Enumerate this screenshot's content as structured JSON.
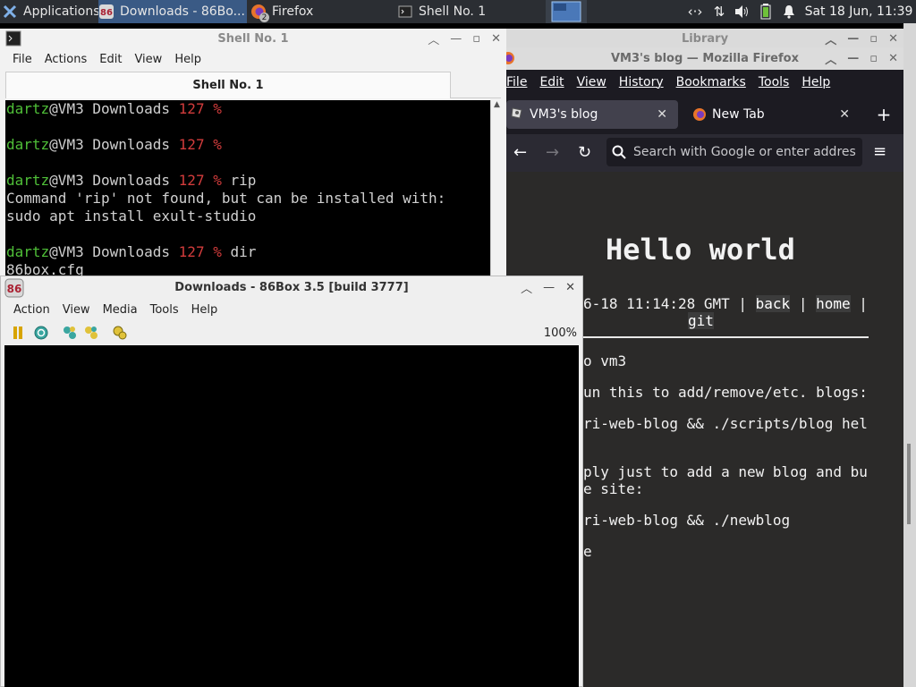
{
  "panel": {
    "apps_label": "Applications",
    "tasks": [
      {
        "label": "Downloads - 86Bo...",
        "icon": "86box-icon",
        "active": true
      },
      {
        "label": "Firefox",
        "icon": "firefox-icon",
        "badge": "2",
        "active": false
      },
      {
        "label": "Shell No. 1",
        "icon": "terminal-icon",
        "active": false
      }
    ],
    "clock": "Sat 18 Jun, 11:39",
    "tray_icons": [
      "network-arrows-icon",
      "transfer-icon",
      "volume-icon",
      "battery-icon",
      "bell-icon"
    ],
    "colors": {
      "panel_bg": "#2b2e33",
      "active_task": "#3a5a85"
    }
  },
  "library": {
    "title": "Library"
  },
  "firefox": {
    "title": "VM3's blog — Mozilla Firefox",
    "menu": [
      "File",
      "Edit",
      "View",
      "History",
      "Bookmarks",
      "Tools",
      "Help"
    ],
    "tabs": [
      {
        "label": "VM3's blog",
        "selected": true
      },
      {
        "label": "New Tab",
        "selected": false
      }
    ],
    "url_placeholder": "Search with Google or enter addres",
    "page": {
      "heading": "Hello world",
      "meta_prefix": "6-18 11:14:28 GMT | ",
      "link_back": "back",
      "link_home": "home",
      "link_git": "git",
      "sep": " | ",
      "lines": [
        "o vm3",
        "un this to add/remove/etc. blogs:",
        "ri-web-blog && ./scripts/blog hel",
        "ply just to add a new blog and bu",
        "e site:",
        "ri-web-blog && ./newblog",
        "e"
      ]
    }
  },
  "shell": {
    "title": "Shell No. 1",
    "tab_label": "Shell No. 1",
    "menu": [
      "File",
      "Actions",
      "Edit",
      "View",
      "Help"
    ],
    "prompt_user": "dartz",
    "prompt_host": "@VM3 Downloads ",
    "prompt_code": "127 %",
    "cmd_rip": " rip",
    "out1": "Command 'rip' not found, but can be installed with:",
    "out2": "sudo apt install exult-studio",
    "cmd_dir": " dir",
    "out3": "86box.cfg"
  },
  "box86": {
    "title": "Downloads - 86Box 3.5 [build 3777]",
    "menu": [
      "Action",
      "View",
      "Media",
      "Tools",
      "Help"
    ],
    "zoom": "100%",
    "toolbar_icons": [
      "pause-icon",
      "reset-icon",
      "ctrl-alt-del-icon",
      "ctrl-alt-esc-icon",
      "settings-icon"
    ]
  }
}
